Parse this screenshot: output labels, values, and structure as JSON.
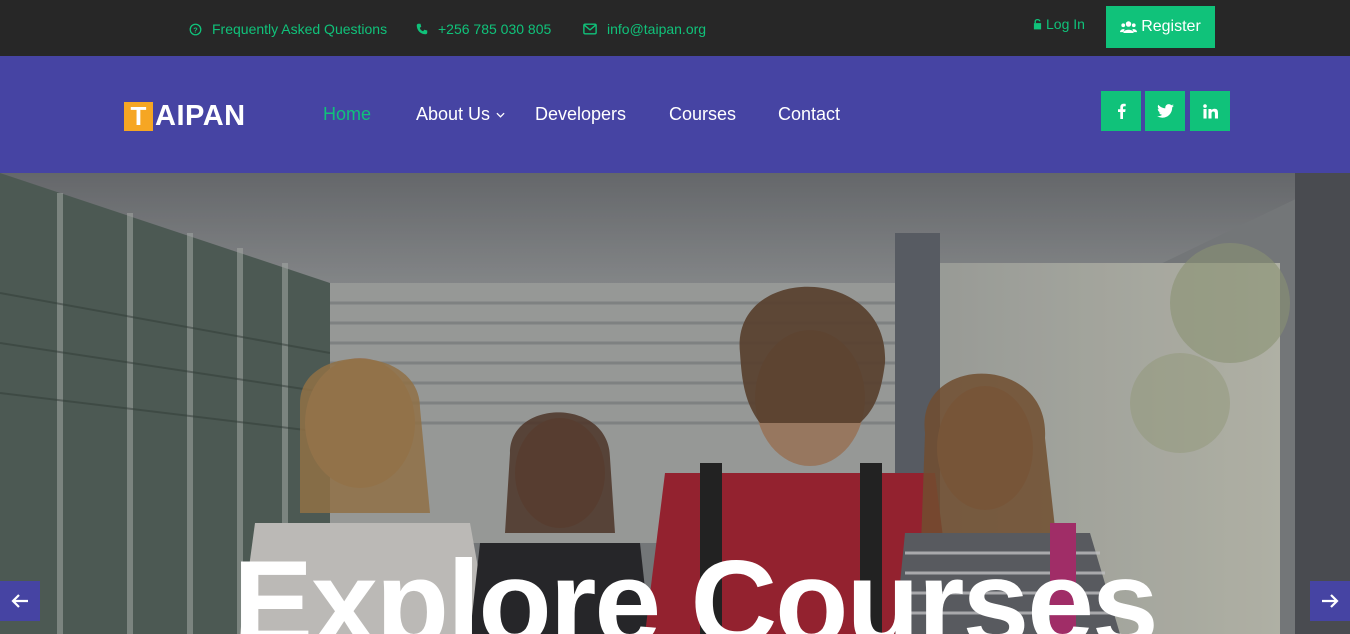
{
  "topbar": {
    "faq_label": "Frequently Asked Questions",
    "phone": "+256 785 030 805",
    "email": "info@taipan.org",
    "login_label": "Log In",
    "register_label": "Register"
  },
  "brand": {
    "logo_initial": "T",
    "logo_rest": "AIPAN"
  },
  "nav": {
    "items": [
      {
        "label": "Home",
        "active": true
      },
      {
        "label": "About Us",
        "has_dropdown": true
      },
      {
        "label": "Developers"
      },
      {
        "label": "Courses"
      },
      {
        "label": "Contact"
      }
    ]
  },
  "social": [
    "facebook-icon",
    "twitter-icon",
    "linkedin-icon"
  ],
  "hero": {
    "title": "Explore Courses"
  },
  "colors": {
    "topbar_bg": "#272727",
    "accent_green": "#10c27a",
    "nav_bg": "#4644a3",
    "logo_orange": "#f6a623"
  }
}
